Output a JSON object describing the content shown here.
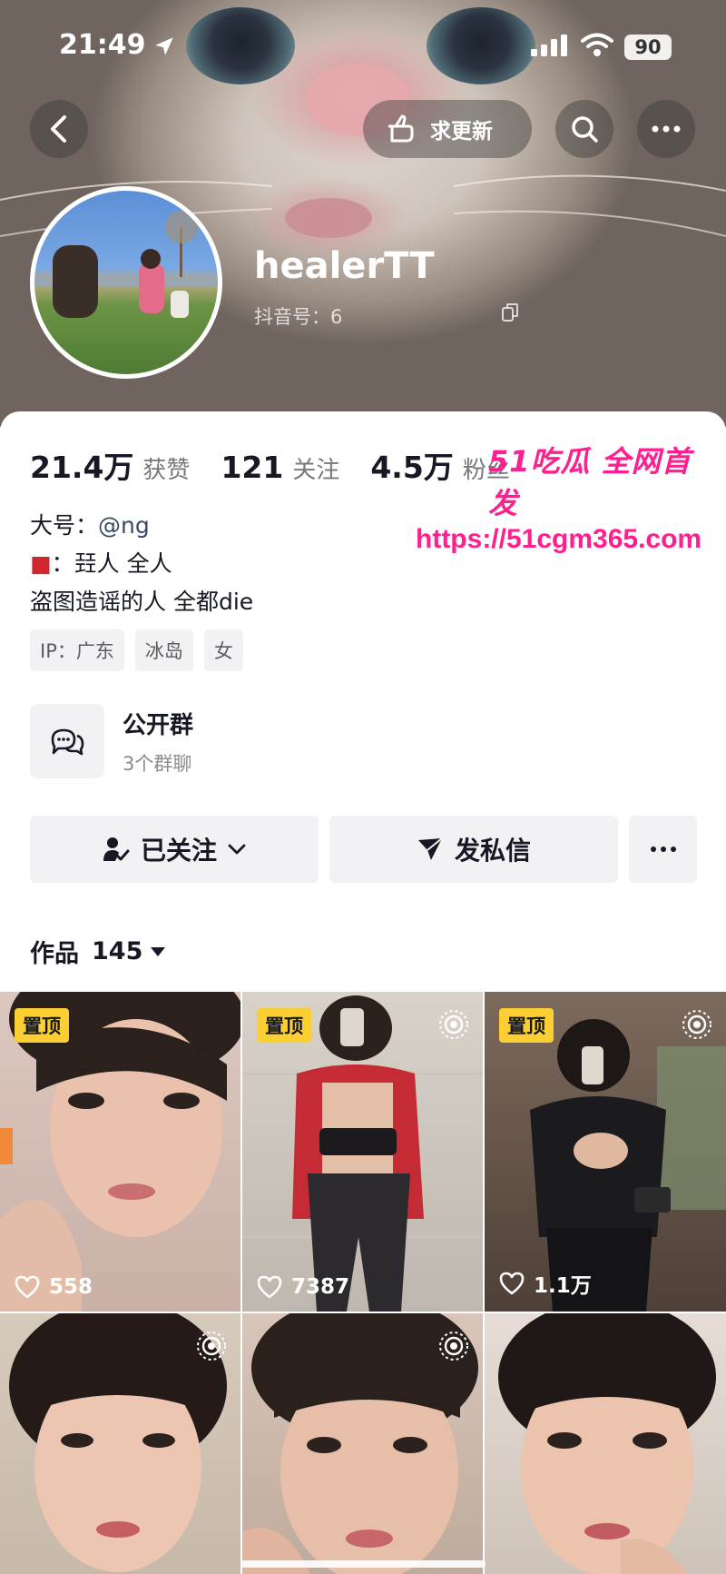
{
  "status_bar": {
    "time": "21:49",
    "battery": "90"
  },
  "header": {
    "request_update_label": "求更新"
  },
  "profile": {
    "username": "healerTT",
    "douyin_id": "抖音号：6"
  },
  "stats": [
    {
      "num": "21.4万",
      "label": "获赞"
    },
    {
      "num": "121",
      "label": "关注"
    },
    {
      "num": "4.5万",
      "label": "粉丝"
    }
  ],
  "watermark": {
    "line1": "51吃瓜 全网首发",
    "line2": "https://51cgm365.com"
  },
  "bio": {
    "line1_prefix": "大号：",
    "line1_handle": "@ng",
    "line2": "：㠭人 全人",
    "line3": "盗图造谣的人 全都die"
  },
  "tags": [
    "IP：广东",
    "冰岛",
    "女"
  ],
  "group": {
    "title": "公开群",
    "subtitle": "3个群聊"
  },
  "actions": {
    "follow_label": "已关注",
    "message_label": "发私信"
  },
  "works": {
    "label": "作品",
    "count": "145"
  },
  "grid": [
    {
      "pinned": "置顶",
      "likes": "558",
      "live": false
    },
    {
      "pinned": "置顶",
      "likes": "7387",
      "live": true
    },
    {
      "pinned": "置顶",
      "likes": "1.1万",
      "live": true
    },
    {
      "pinned": "",
      "likes": "",
      "live": true
    },
    {
      "pinned": "",
      "likes": "",
      "live": true
    },
    {
      "pinned": "",
      "likes": "",
      "live": false
    }
  ]
}
